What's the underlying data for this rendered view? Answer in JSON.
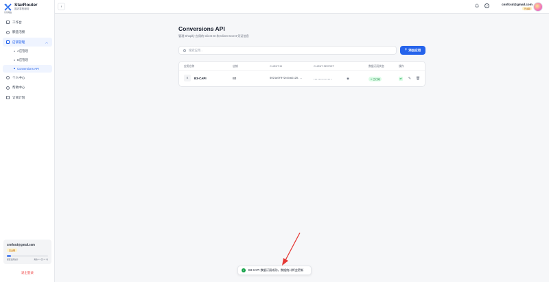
{
  "brand": {
    "name": "StarRouter",
    "subtitle": "国内零售服务",
    "small": "星星路由"
  },
  "nav": {
    "items": [
      {
        "label": "工作台"
      },
      {
        "label": "额品活接"
      },
      {
        "label": "店铺管理"
      }
    ],
    "sub_items": [
      {
        "label": "A店管理"
      },
      {
        "label": "B店管理"
      },
      {
        "label": "Conversions API"
      }
    ],
    "items_after": [
      {
        "label": "个人中心"
      },
      {
        "label": "帮助中心"
      },
      {
        "label": "订阅计划"
      }
    ]
  },
  "user_card": {
    "email": "cnnfcsd@gmail.com",
    "badge": "已过期",
    "progress": 0.1,
    "left_text": "额度使用统计",
    "right_text": "剩余 13 天 17 时"
  },
  "logout_label": "退出登录",
  "topbar": {
    "email": "cnnfcsd@gmail.com",
    "badge": "已过期",
    "bell_icon": "bell-icon",
    "help_icon": "help-icon"
  },
  "page": {
    "title": "Conversions API",
    "subtitle": "管理 Shopify 应用的 Client ID 和 Client Secret 凭证信息",
    "search_placeholder": "搜索应用...",
    "add_button": "添加应用"
  },
  "table": {
    "headers": [
      "应用名称",
      "店铺",
      "CLIENT ID",
      "CLIENT SECRET",
      "数据订阅状态",
      "操作"
    ],
    "rows": [
      {
        "icon_letter": "B",
        "name": "B3-CAPI",
        "store": "B3",
        "client_id": "6021a5f0f2c4ba5128...",
        "client_secret": "••••••••••••••",
        "status": "已订阅"
      }
    ]
  },
  "toast": {
    "text": "B3-CAPI 数据订阅成功，数据统计将会更新"
  },
  "colors": {
    "accent": "#2563eb",
    "success": "#16a34a",
    "danger": "#ef4444",
    "annotation": "#e53935"
  }
}
